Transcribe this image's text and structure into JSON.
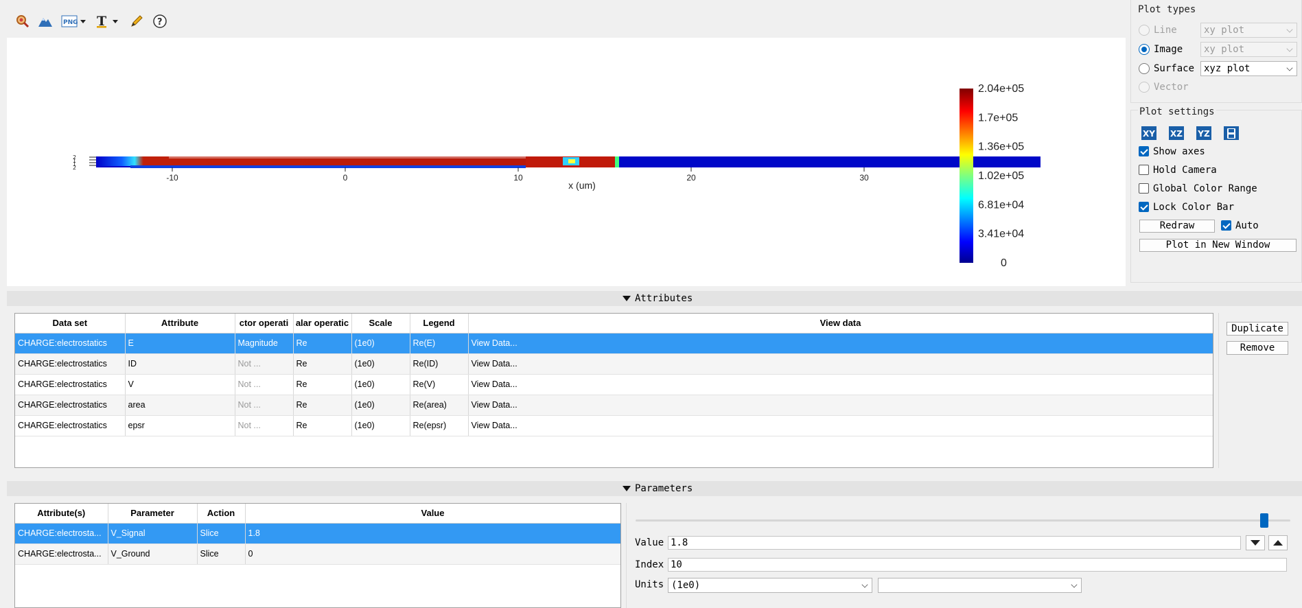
{
  "toolbar": {
    "icons": [
      "zoom-icon",
      "mountain-icon",
      "png-export-icon",
      "text-icon",
      "pencil-icon",
      "help-icon"
    ]
  },
  "plot": {
    "x_axis_label": "x (um)",
    "x_ticks": [
      "-10",
      "0",
      "10",
      "20",
      "30"
    ],
    "colorbar_ticks": [
      "2.04e+05",
      "1.7e+05",
      "1.36e+05",
      "1.02e+05",
      "6.81e+04",
      "3.41e+04",
      "0"
    ],
    "colorbar_range": [
      0,
      204000
    ]
  },
  "plot_types": {
    "title": "Plot types",
    "options": [
      {
        "label": "Line",
        "combo": "xy plot",
        "state": "disabled"
      },
      {
        "label": "Image",
        "combo": "xy plot",
        "state": "checked"
      },
      {
        "label": "Surface",
        "combo": "xyz plot",
        "state": "enabled"
      },
      {
        "label": "Vector",
        "combo": "",
        "state": "disabled"
      }
    ]
  },
  "plot_settings": {
    "title": "Plot settings",
    "view_buttons": [
      "XY",
      "XZ",
      "YZ"
    ],
    "checkboxes": [
      {
        "label": "Show axes",
        "checked": true
      },
      {
        "label": "Hold Camera",
        "checked": false
      },
      {
        "label": "Global Color Range",
        "checked": false
      },
      {
        "label": "Lock Color Bar",
        "checked": true
      }
    ],
    "redraw_label": "Redraw",
    "auto_label": "Auto",
    "auto_checked": true,
    "new_window_label": "Plot in New Window"
  },
  "attributes": {
    "section_title": "Attributes",
    "columns": [
      "Data set",
      "Attribute",
      "ctor operati",
      "alar operatic",
      "Scale",
      "Legend",
      "View data"
    ],
    "rows": [
      [
        "CHARGE:electrostatics",
        "E",
        "Magnitude",
        "Re",
        "(1e0)",
        "Re(E)",
        "View Data..."
      ],
      [
        "CHARGE:electrostatics",
        "ID",
        "Not ...",
        "Re",
        "(1e0)",
        "Re(ID)",
        "View Data..."
      ],
      [
        "CHARGE:electrostatics",
        "V",
        "Not ...",
        "Re",
        "(1e0)",
        "Re(V)",
        "View Data..."
      ],
      [
        "CHARGE:electrostatics",
        "area",
        "Not ...",
        "Re",
        "(1e0)",
        "Re(area)",
        "View Data..."
      ],
      [
        "CHARGE:electrostatics",
        "epsr",
        "Not ...",
        "Re",
        "(1e0)",
        "Re(epsr)",
        "View Data..."
      ]
    ],
    "duplicate_label": "Duplicate",
    "remove_label": "Remove"
  },
  "parameters": {
    "section_title": "Parameters",
    "columns": [
      "Attribute(s)",
      "Parameter",
      "Action",
      "Value"
    ],
    "rows": [
      [
        "CHARGE:electrosta...",
        "V_Signal",
        "Slice",
        "1.8"
      ],
      [
        "CHARGE:electrosta...",
        "V_Ground",
        "Slice",
        "0"
      ]
    ],
    "slider_fraction": 0.96,
    "value_label": "Value",
    "value": "1.8",
    "index_label": "Index",
    "index": "10",
    "units_label": "Units",
    "units_value": "(1e0)",
    "units_value2": ""
  }
}
